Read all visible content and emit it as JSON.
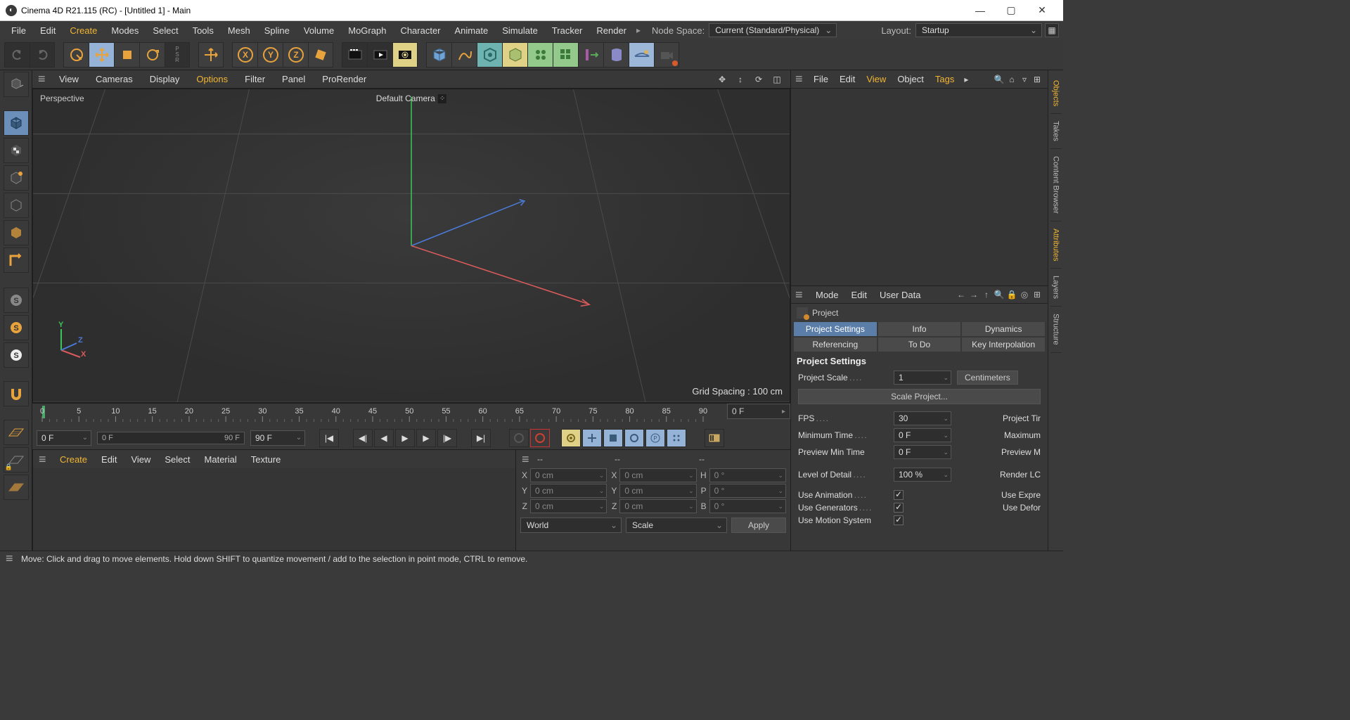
{
  "window": {
    "title": "Cinema 4D R21.115 (RC) - [Untitled 1] - Main",
    "min": "—",
    "max": "▢",
    "close": "✕"
  },
  "menu": {
    "items": [
      "File",
      "Edit",
      "Create",
      "Modes",
      "Select",
      "Tools",
      "Mesh",
      "Spline",
      "Volume",
      "MoGraph",
      "Character",
      "Animate",
      "Simulate",
      "Tracker",
      "Render"
    ],
    "accent_idx": 2,
    "nodespace_lbl": "Node Space:",
    "nodespace_val": "Current (Standard/Physical)",
    "layout_lbl": "Layout:",
    "layout_val": "Startup"
  },
  "viewbar": {
    "items": [
      "View",
      "Cameras",
      "Display",
      "Options",
      "Filter",
      "Panel",
      "ProRender"
    ],
    "accent_idx": 3
  },
  "viewport": {
    "label": "Perspective",
    "camera": "Default Camera",
    "grid": "Grid Spacing : 100 cm",
    "gizmo": {
      "x": "X",
      "y": "Y",
      "z": "Z"
    }
  },
  "timeline": {
    "marks": [
      0,
      5,
      10,
      15,
      20,
      25,
      30,
      35,
      40,
      45,
      50,
      55,
      60,
      65,
      70,
      75,
      80,
      85,
      90
    ],
    "cur": "0 F",
    "start": "0 F",
    "end": "90 F",
    "left": "0 F",
    "right": "90 F"
  },
  "materialbar": {
    "items": [
      "Create",
      "Edit",
      "View",
      "Select",
      "Material",
      "Texture"
    ],
    "accent_idx": 0
  },
  "coord": {
    "header": "--",
    "rows": [
      {
        "l": "X",
        "a": "0 cm",
        "b": "X",
        "c": "0 cm",
        "d": "H",
        "e": "0 °"
      },
      {
        "l": "Y",
        "a": "0 cm",
        "b": "Y",
        "c": "0 cm",
        "d": "P",
        "e": "0 °"
      },
      {
        "l": "Z",
        "a": "0 cm",
        "b": "Z",
        "c": "0 cm",
        "d": "B",
        "e": "0 °"
      }
    ],
    "world": "World",
    "scale": "Scale",
    "apply": "Apply"
  },
  "obj_panel": {
    "menu": [
      "File",
      "Edit",
      "View",
      "Object",
      "Tags"
    ],
    "accent_idx": 2
  },
  "attr_panel": {
    "menu": [
      "Mode",
      "Edit",
      "User Data"
    ],
    "title": "Project",
    "tabs1": [
      "Project Settings",
      "Info",
      "Dynamics"
    ],
    "tabs2": [
      "Referencing",
      "To Do",
      "Key Interpolation"
    ],
    "section": "Project Settings",
    "props": {
      "scale_lbl": "Project Scale",
      "scale_val": "1",
      "scale_unit": "Centimeters",
      "scale_btn": "Scale Project...",
      "fps_lbl": "FPS",
      "fps_val": "30",
      "fps_extra": "Project Tir",
      "min_lbl": "Minimum Time",
      "min_val": "0 F",
      "min_extra": "Maximum",
      "prev_lbl": "Preview Min Time",
      "prev_val": "0 F",
      "prev_extra": "Preview M",
      "lod_lbl": "Level of Detail",
      "lod_val": "100 %",
      "lod_extra": "Render LC",
      "anim_lbl": "Use Animation",
      "anim_extra": "Use Expre",
      "gen_lbl": "Use Generators",
      "gen_extra": "Use Defor",
      "motion_lbl": "Use Motion System"
    }
  },
  "sidetabs": [
    "Objects",
    "Takes",
    "Content Browser",
    "Attributes",
    "Layers",
    "Structure"
  ],
  "status": "Move: Click and drag to move elements. Hold down SHIFT to quantize movement / add to the selection in point mode, CTRL to remove."
}
